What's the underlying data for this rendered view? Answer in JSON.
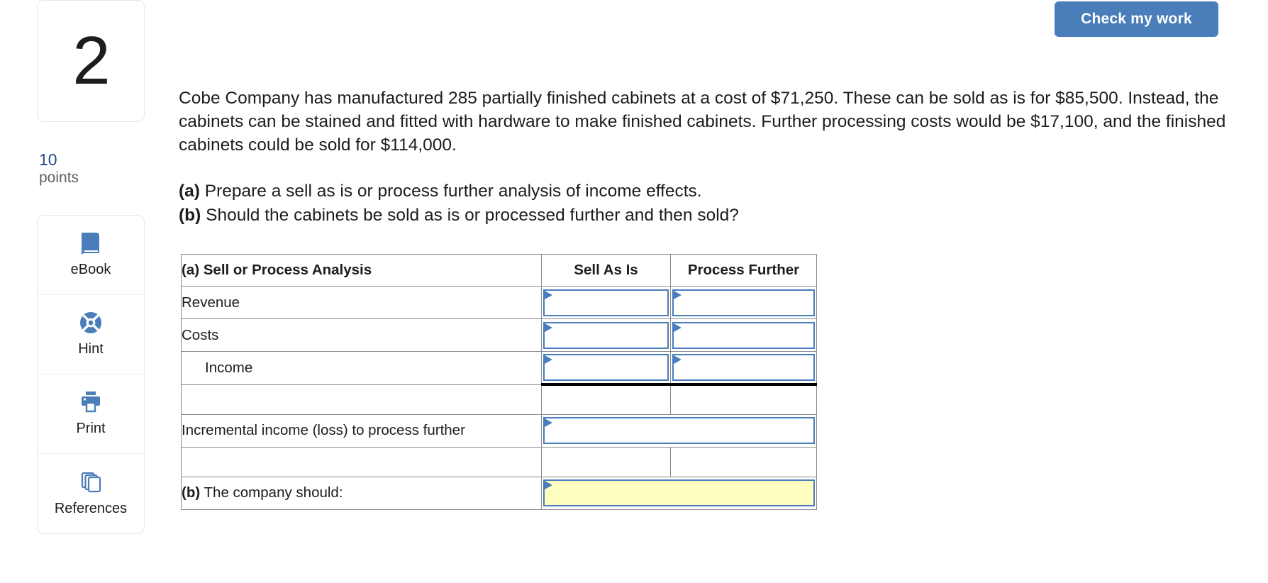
{
  "header": {
    "check_my_work_label": "Check my work"
  },
  "sidebar": {
    "question_number": "2",
    "points_value": "10",
    "points_label": "points",
    "tools": [
      {
        "label": "eBook",
        "icon": "book-icon"
      },
      {
        "label": "Hint",
        "icon": "life-ring-icon"
      },
      {
        "label": "Print",
        "icon": "printer-icon"
      },
      {
        "label": "References",
        "icon": "documents-stack-icon"
      }
    ]
  },
  "question": {
    "paragraph": "Cobe Company has manufactured 285 partially finished cabinets at a cost of $71,250. These can be sold as is for $85,500. Instead, the cabinets can be stained and fitted with hardware to make finished cabinets. Further processing costs would be $17,100, and the finished cabinets could be sold for $114,000.",
    "part_a_marker": "(a)",
    "part_a_text": "Prepare a sell as is or process further analysis of income effects.",
    "part_b_marker": "(b)",
    "part_b_text": "Should the cabinets be sold as is or processed further and then sold?"
  },
  "table": {
    "headers": {
      "analysis": "(a) Sell or Process Analysis",
      "sell_as_is": "Sell As Is",
      "process_further": "Process Further"
    },
    "rows": [
      {
        "label": "Revenue",
        "indent": false,
        "sell_as_is": "",
        "process_further": ""
      },
      {
        "label": "Costs",
        "indent": false,
        "sell_as_is": "",
        "process_further": ""
      },
      {
        "label": "Income",
        "indent": true,
        "sell_as_is": "",
        "process_further": ""
      }
    ],
    "incremental": {
      "label": "Incremental income (loss) to process further",
      "value": ""
    },
    "conclusion": {
      "marker": "(b)",
      "label": "The company should:",
      "value": ""
    }
  },
  "colors": {
    "header_blue": "#8FB4DE",
    "accent_blue": "#4A7EBB",
    "input_yellow": "#FFFFBF",
    "points_blue": "#234A87",
    "grid_gray": "#8A8A8A"
  }
}
